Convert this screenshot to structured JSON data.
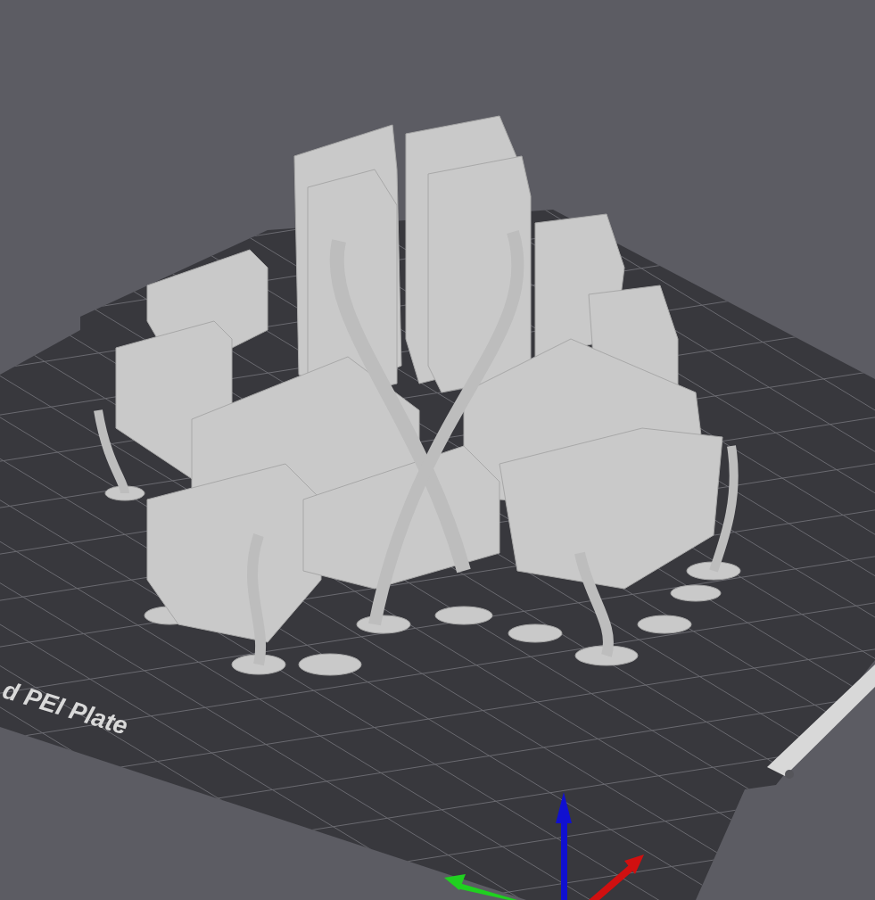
{
  "viewport": {
    "bed_label": "d PEI Plate"
  }
}
